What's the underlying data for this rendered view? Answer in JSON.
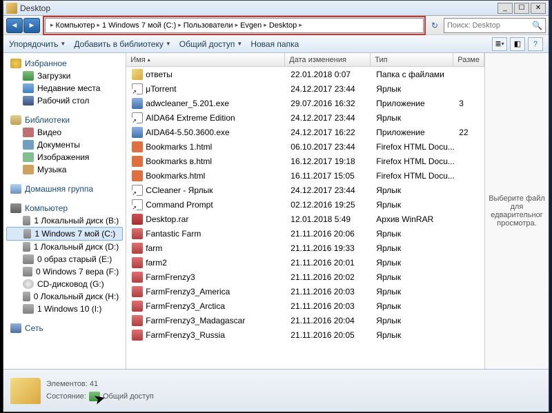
{
  "window": {
    "title": "Desktop"
  },
  "breadcrumb": {
    "items": [
      "Компьютер",
      "1 Windows 7 мой (C:)",
      "Пользователи",
      "Evgen",
      "Desktop"
    ]
  },
  "search": {
    "placeholder": "Поиск: Desktop"
  },
  "toolbar": {
    "organize": "Упорядочить",
    "library": "Добавить в библиотеку",
    "share": "Общий доступ",
    "newfolder": "Новая папка"
  },
  "sidebar": {
    "favorites": {
      "label": "Избранное",
      "items": [
        "Загрузки",
        "Недавние места",
        "Рабочий стол"
      ]
    },
    "libraries": {
      "label": "Библиотеки",
      "items": [
        "Видео",
        "Документы",
        "Изображения",
        "Музыка"
      ]
    },
    "homegroup": {
      "label": "Домашняя группа"
    },
    "computer": {
      "label": "Компьютер",
      "items": [
        "1 Локальный диск (B:)",
        "1 Windows 7 мой (C:)",
        "1 Локальный диск (D:)",
        "0 образ старый (E:)",
        "0 Windows 7 вера (F:)",
        "CD-дисковод (G:)",
        "0 Локальный диск (H:)",
        "1 Windows 10 (I:)"
      ],
      "selected": 1
    },
    "network": {
      "label": "Сеть"
    }
  },
  "columns": {
    "name": "Имя",
    "date": "Дата изменения",
    "type": "Тип",
    "size": "Разме"
  },
  "files": [
    {
      "icon": "folder",
      "name": "ответы",
      "date": "22.01.2018 0:07",
      "type": "Папка с файлами",
      "size": ""
    },
    {
      "icon": "link",
      "name": "μTorrent",
      "date": "24.12.2017 23:44",
      "type": "Ярлык",
      "size": ""
    },
    {
      "icon": "exe",
      "name": "adwcleaner_5.201.exe",
      "date": "29.07.2016 16:32",
      "type": "Приложение",
      "size": "3"
    },
    {
      "icon": "link",
      "name": "AIDA64 Extreme Edition",
      "date": "24.12.2017 23:44",
      "type": "Ярлык",
      "size": ""
    },
    {
      "icon": "exe",
      "name": "AIDA64-5.50.3600.exe",
      "date": "24.12.2017 16:22",
      "type": "Приложение",
      "size": "22"
    },
    {
      "icon": "html",
      "name": "Bookmarks 1.html",
      "date": "06.10.2017 23:44",
      "type": "Firefox HTML Docu...",
      "size": ""
    },
    {
      "icon": "html",
      "name": "Bookmarks в.html",
      "date": "16.12.2017 19:18",
      "type": "Firefox HTML Docu...",
      "size": ""
    },
    {
      "icon": "html",
      "name": "Bookmarks.html",
      "date": "16.11.2017 15:05",
      "type": "Firefox HTML Docu...",
      "size": ""
    },
    {
      "icon": "link",
      "name": "CCleaner - Ярлык",
      "date": "24.12.2017 23:44",
      "type": "Ярлык",
      "size": ""
    },
    {
      "icon": "link",
      "name": "Command Prompt",
      "date": "02.12.2016 19:25",
      "type": "Ярлык",
      "size": ""
    },
    {
      "icon": "rar",
      "name": "Desktop.rar",
      "date": "12.01.2018 5:49",
      "type": "Архив WinRAR",
      "size": ""
    },
    {
      "icon": "game",
      "name": "Fantastic Farm",
      "date": "21.11.2016 20:06",
      "type": "Ярлык",
      "size": ""
    },
    {
      "icon": "game",
      "name": "farm",
      "date": "21.11.2016 19:33",
      "type": "Ярлык",
      "size": ""
    },
    {
      "icon": "game",
      "name": "farm2",
      "date": "21.11.2016 20:01",
      "type": "Ярлык",
      "size": ""
    },
    {
      "icon": "game",
      "name": "FarmFrenzy3",
      "date": "21.11.2016 20:02",
      "type": "Ярлык",
      "size": ""
    },
    {
      "icon": "game",
      "name": "FarmFrenzy3_America",
      "date": "21.11.2016 20:03",
      "type": "Ярлык",
      "size": ""
    },
    {
      "icon": "game",
      "name": "FarmFrenzy3_Arctica",
      "date": "21.11.2016 20:03",
      "type": "Ярлык",
      "size": ""
    },
    {
      "icon": "game",
      "name": "FarmFrenzy3_Madagascar",
      "date": "21.11.2016 20:04",
      "type": "Ярлык",
      "size": ""
    },
    {
      "icon": "game",
      "name": "FarmFrenzy3_Russia",
      "date": "21.11.2016 20:05",
      "type": "Ярлык",
      "size": ""
    }
  ],
  "preview": {
    "text": "Выберите файл для едварительног просмотра."
  },
  "status": {
    "count_label": "Элементов:",
    "count": "41",
    "state_label": "Состояние:",
    "state_value": "Общий доступ"
  }
}
